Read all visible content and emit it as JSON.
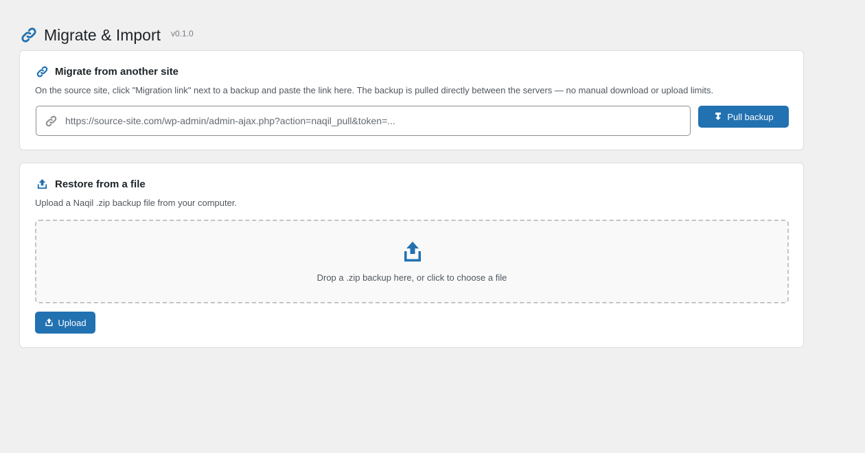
{
  "header": {
    "title": "Migrate & Import",
    "version": "v0.1.0",
    "icon": "link-icon"
  },
  "migrate": {
    "title": "Migrate from another site",
    "description": "On the source site, click \"Migration link\" next to a backup and paste the link here. The backup is pulled directly between the servers — no manual download or upload limits.",
    "input_value": "",
    "input_placeholder": "https://source-site.com/wp-admin/admin-ajax.php?action=naqil_pull&token=...",
    "button_label": "Pull backup",
    "icons": [
      "link-icon",
      "download-icon"
    ]
  },
  "restore": {
    "title": "Restore from a file",
    "description": "Upload a Naqil .zip backup file from your computer.",
    "dropzone_text": "Drop a .zip backup here, or click to choose a file",
    "button_label": "Upload",
    "icons": [
      "upload-icon"
    ]
  },
  "colors": {
    "accent": "#2271b1",
    "background": "#f0f0f1",
    "card": "#ffffff",
    "border": "#dcdcde",
    "muted_text": "#50575e"
  }
}
